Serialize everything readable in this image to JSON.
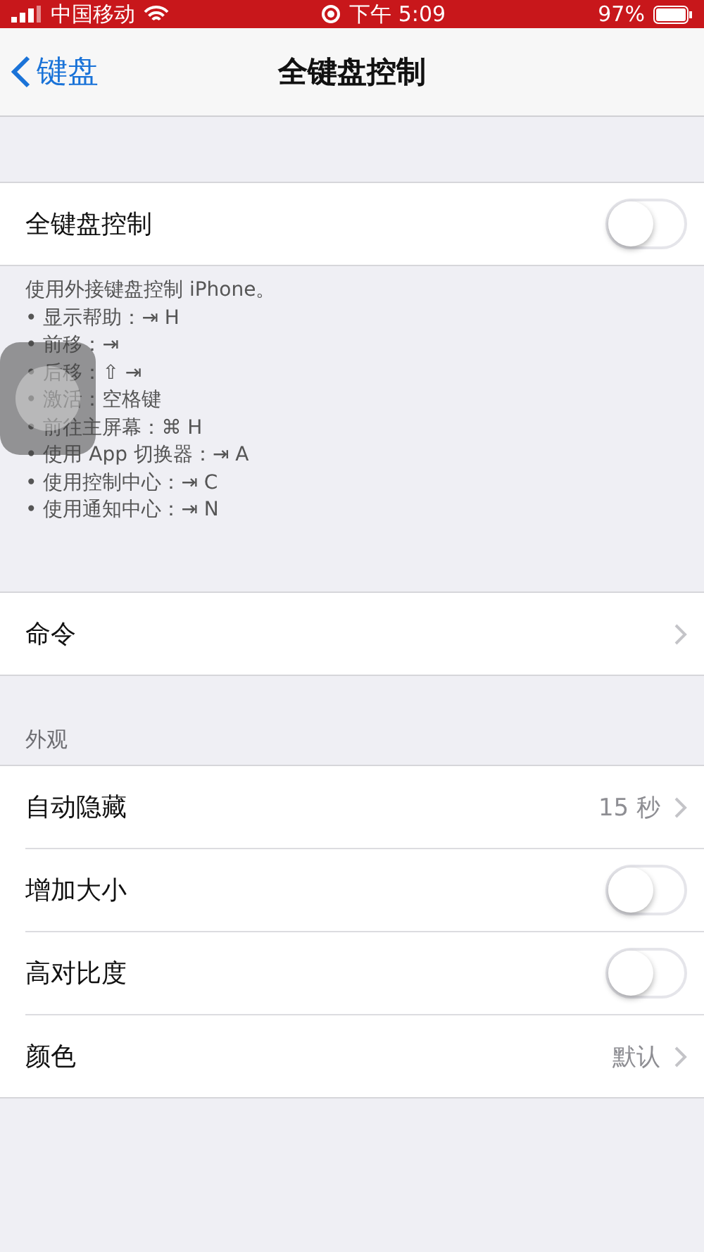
{
  "status_bar": {
    "carrier": "中国移动",
    "time": "下午 5:09",
    "battery": "97%"
  },
  "nav": {
    "back": "键盘",
    "title": "全键盘控制"
  },
  "sections": [
    {
      "rows": [
        {
          "kind": "toggle",
          "label": "全键盘控制",
          "on": false
        }
      ],
      "footer": {
        "intro": "使用外接键盘控制 iPhone。",
        "lines": [
          "•  显示帮助：⇥ H",
          "•  前移：⇥",
          "•  后移：⇧ ⇥",
          "•  激活：空格键",
          "•  前往主屏幕：⌘ H",
          "•  使用 App 切换器：⇥ A",
          "•  使用控制中心：⇥ C",
          "•  使用通知中心：⇥ N"
        ]
      }
    },
    {
      "rows": [
        {
          "kind": "link",
          "label": "命令"
        }
      ]
    },
    {
      "header": "外观",
      "rows": [
        {
          "kind": "link",
          "label": "自动隐藏",
          "value": "15 秒"
        },
        {
          "kind": "toggle",
          "label": "增加大小",
          "on": false
        },
        {
          "kind": "toggle",
          "label": "高对比度",
          "on": false
        },
        {
          "kind": "link",
          "label": "颜色",
          "value": "默认"
        }
      ]
    }
  ],
  "floating_button": {
    "visible": true
  }
}
